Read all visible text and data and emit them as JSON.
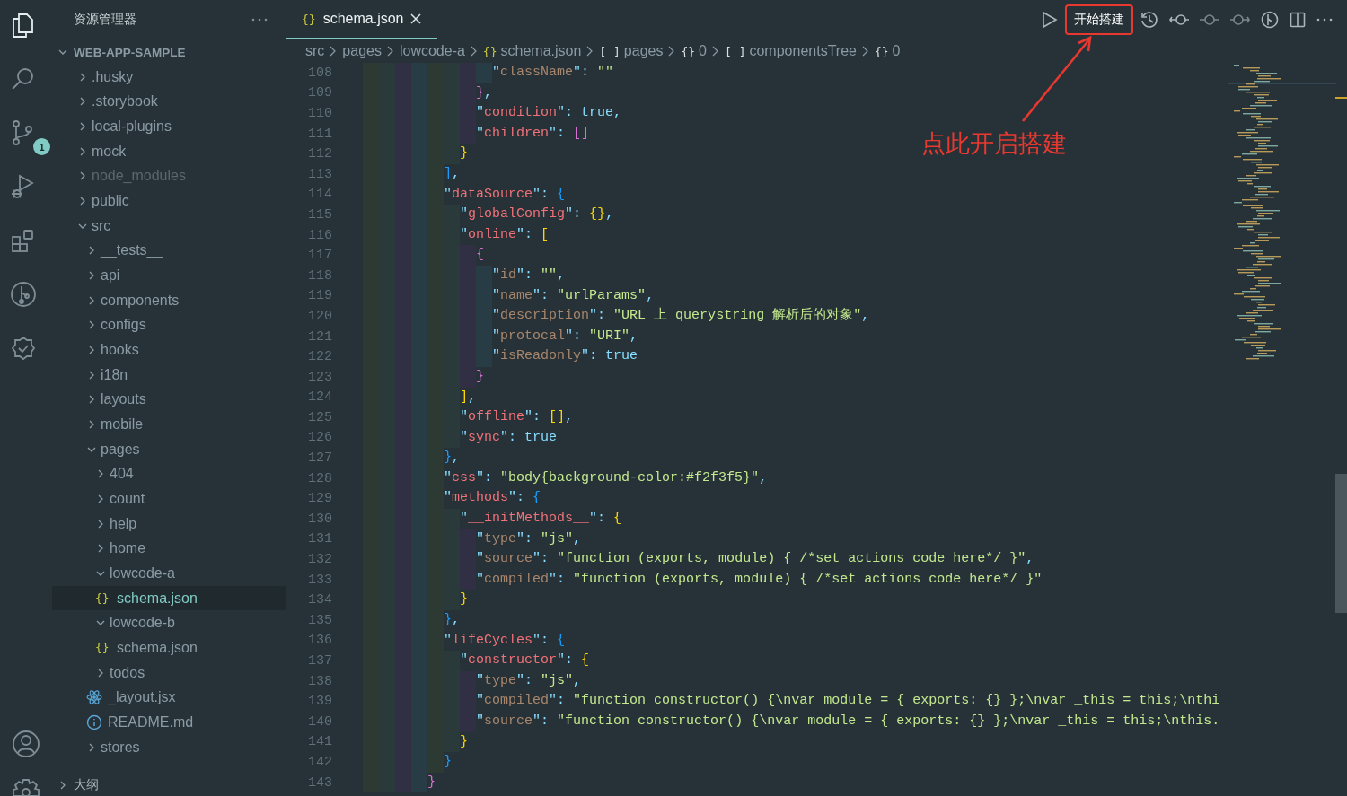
{
  "activity_bar": {
    "items": [
      {
        "kind": "explorer",
        "selected": true
      },
      {
        "kind": "search",
        "selected": false
      },
      {
        "kind": "source-control",
        "selected": false,
        "badge": "1"
      },
      {
        "kind": "debug",
        "selected": false
      },
      {
        "kind": "extensions",
        "selected": false
      },
      {
        "kind": "git-graph",
        "selected": false
      },
      {
        "kind": "checklist",
        "selected": false
      }
    ],
    "bottom": [
      {
        "kind": "account"
      },
      {
        "kind": "settings"
      }
    ]
  },
  "explorer": {
    "title": "资源管理器",
    "project": {
      "name": "WEB-APP-SAMPLE",
      "expanded": true,
      "children": [
        {
          "name": ".husky",
          "kind": "folder",
          "expanded": false,
          "selected": false,
          "dimmed": false
        },
        {
          "name": ".storybook",
          "kind": "folder",
          "expanded": false,
          "selected": false,
          "dimmed": false
        },
        {
          "name": "local-plugins",
          "kind": "folder",
          "expanded": false,
          "selected": false,
          "dimmed": false
        },
        {
          "name": "mock",
          "kind": "folder",
          "expanded": false,
          "selected": false,
          "dimmed": false
        },
        {
          "name": "node_modules",
          "kind": "folder",
          "expanded": false,
          "selected": false,
          "dimmed": true
        },
        {
          "name": "public",
          "kind": "folder",
          "expanded": false,
          "selected": false,
          "dimmed": false
        },
        {
          "name": "src",
          "kind": "folder",
          "expanded": true,
          "selected": false,
          "dimmed": false,
          "children": [
            {
              "name": "__tests__",
              "kind": "folder",
              "expanded": false,
              "selected": false,
              "dimmed": false
            },
            {
              "name": "api",
              "kind": "folder",
              "expanded": false,
              "selected": false,
              "dimmed": false
            },
            {
              "name": "components",
              "kind": "folder",
              "expanded": false,
              "selected": false,
              "dimmed": false
            },
            {
              "name": "configs",
              "kind": "folder",
              "expanded": false,
              "selected": false,
              "dimmed": false
            },
            {
              "name": "hooks",
              "kind": "folder",
              "expanded": false,
              "selected": false,
              "dimmed": false
            },
            {
              "name": "i18n",
              "kind": "folder",
              "expanded": false,
              "selected": false,
              "dimmed": false
            },
            {
              "name": "layouts",
              "kind": "folder",
              "expanded": false,
              "selected": false,
              "dimmed": false
            },
            {
              "name": "mobile",
              "kind": "folder",
              "expanded": false,
              "selected": false,
              "dimmed": false
            },
            {
              "name": "pages",
              "kind": "folder",
              "expanded": true,
              "selected": false,
              "dimmed": false,
              "children": [
                {
                  "name": "404",
                  "kind": "folder",
                  "expanded": false,
                  "selected": false,
                  "dimmed": false
                },
                {
                  "name": "count",
                  "kind": "folder",
                  "expanded": false,
                  "selected": false,
                  "dimmed": false
                },
                {
                  "name": "help",
                  "kind": "folder",
                  "expanded": false,
                  "selected": false,
                  "dimmed": false
                },
                {
                  "name": "home",
                  "kind": "folder",
                  "expanded": false,
                  "selected": false,
                  "dimmed": false
                },
                {
                  "name": "lowcode-a",
                  "kind": "folder",
                  "expanded": true,
                  "selected": false,
                  "dimmed": false,
                  "children": [
                    {
                      "name": "schema.json",
                      "kind": "json",
                      "glyph": "{}",
                      "selected": true,
                      "dimmed": false
                    }
                  ]
                },
                {
                  "name": "lowcode-b",
                  "kind": "folder",
                  "expanded": true,
                  "selected": false,
                  "dimmed": false,
                  "children": [
                    {
                      "name": "schema.json",
                      "kind": "json",
                      "glyph": "{}",
                      "selected": false,
                      "dimmed": false
                    }
                  ]
                },
                {
                  "name": "todos",
                  "kind": "folder",
                  "expanded": false,
                  "selected": false,
                  "dimmed": false
                },
                {
                  "name": "_layout.jsx",
                  "kind": "react",
                  "selected": false,
                  "dimmed": false
                },
                {
                  "name": "README.md",
                  "kind": "info",
                  "selected": false,
                  "dimmed": false
                }
              ]
            },
            {
              "name": "stores",
              "kind": "folder",
              "expanded": false,
              "selected": false,
              "dimmed": false
            }
          ]
        }
      ]
    },
    "outline": {
      "title": "大纲",
      "expanded": false
    }
  },
  "editor": {
    "tabs": [
      {
        "glyph": "{}",
        "label": "schema.json",
        "selected": true
      }
    ],
    "toolbar": {
      "build_button": "开始搭建"
    },
    "breadcrumbs": [
      {
        "label": "src"
      },
      {
        "label": "pages"
      },
      {
        "label": "lowcode-a"
      },
      {
        "glyph": "{}",
        "label": "schema.json"
      },
      {
        "glyph": "[ ]",
        "label": "pages"
      },
      {
        "glyph": "{}",
        "label": "0"
      },
      {
        "glyph": "[ ]",
        "label": "componentsTree"
      },
      {
        "glyph": "{}",
        "label": "0"
      }
    ],
    "lines": [
      {
        "number": "108",
        "text": "                \"className\": \"\"",
        "muted_key": true
      },
      {
        "number": "109",
        "text": "              },"
      },
      {
        "number": "110",
        "text": "              \"condition\": true,",
        "muted_key": false
      },
      {
        "number": "111",
        "text": "              \"children\": []",
        "muted_key": false
      },
      {
        "number": "112",
        "text": "            }"
      },
      {
        "number": "113",
        "text": "          ],"
      },
      {
        "number": "114",
        "text": "          \"dataSource\": {",
        "muted_key": false
      },
      {
        "number": "115",
        "text": "            \"globalConfig\": {},",
        "muted_key": false
      },
      {
        "number": "116",
        "text": "            \"online\": [",
        "muted_key": false
      },
      {
        "number": "117",
        "text": "              {"
      },
      {
        "number": "118",
        "text": "                \"id\": \"\",",
        "muted_key": true
      },
      {
        "number": "119",
        "text": "                \"name\": \"urlParams\",",
        "muted_key": true
      },
      {
        "number": "120",
        "text": "                \"description\": \"URL 上 querystring 解析后的对象\",",
        "muted_key": true
      },
      {
        "number": "121",
        "text": "                \"protocal\": \"URI\",",
        "muted_key": true
      },
      {
        "number": "122",
        "text": "                \"isReadonly\": true",
        "muted_key": true
      },
      {
        "number": "123",
        "text": "              }"
      },
      {
        "number": "124",
        "text": "            ],"
      },
      {
        "number": "125",
        "text": "            \"offline\": [],",
        "muted_key": false
      },
      {
        "number": "126",
        "text": "            \"sync\": true",
        "muted_key": false
      },
      {
        "number": "127",
        "text": "          },"
      },
      {
        "number": "128",
        "text": "          \"css\": \"body{background-color:#f2f3f5}\",",
        "muted_key": false
      },
      {
        "number": "129",
        "text": "          \"methods\": {",
        "muted_key": false
      },
      {
        "number": "130",
        "text": "            \"__initMethods__\": {",
        "muted_key": false
      },
      {
        "number": "131",
        "text": "              \"type\": \"js\",",
        "muted_key": true
      },
      {
        "number": "132",
        "text": "              \"source\": \"function (exports, module) { /*set actions code here*/ }\",",
        "muted_key": true
      },
      {
        "number": "133",
        "text": "              \"compiled\": \"function (exports, module) { /*set actions code here*/ }\"",
        "muted_key": true
      },
      {
        "number": "134",
        "text": "            }"
      },
      {
        "number": "135",
        "text": "          },"
      },
      {
        "number": "136",
        "text": "          \"lifeCycles\": {",
        "muted_key": false
      },
      {
        "number": "137",
        "text": "            \"constructor\": {",
        "muted_key": false
      },
      {
        "number": "138",
        "text": "              \"type\": \"js\",",
        "muted_key": true
      },
      {
        "number": "139",
        "text": "              \"compiled\": \"function constructor() {\\nvar module = { exports: {} };\\nvar _this = this;\\nthi",
        "muted_key": true
      },
      {
        "number": "140",
        "text": "              \"source\": \"function constructor() {\\nvar module = { exports: {} };\\nvar _this = this;\\nthis.",
        "muted_key": true
      },
      {
        "number": "141",
        "text": "            }"
      },
      {
        "number": "142",
        "text": "          }"
      },
      {
        "number": "143",
        "text": "        }"
      }
    ]
  },
  "annotation": {
    "text": "点此开启搭建"
  }
}
